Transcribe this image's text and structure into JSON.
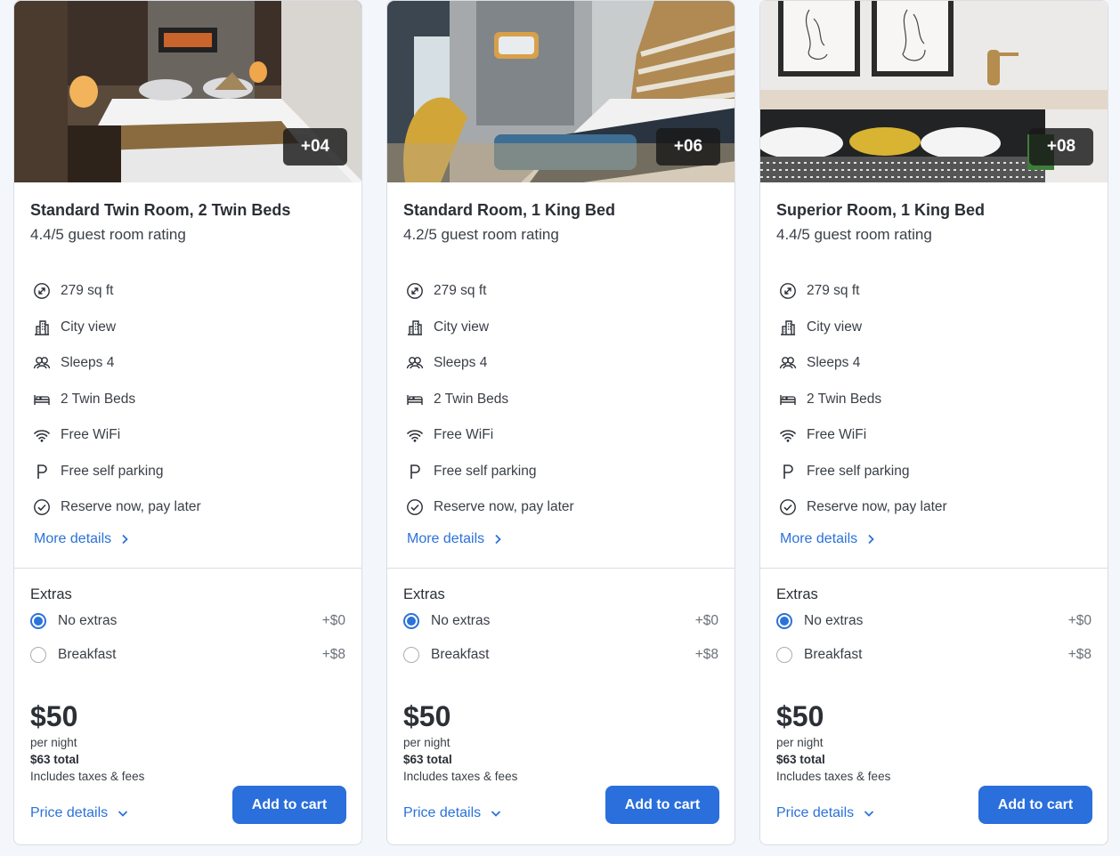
{
  "rooms": [
    {
      "photo_count": "+04",
      "name": "Standard Twin Room, 2 Twin Beds",
      "rating": "4.4/5 guest room rating",
      "amenities": [
        "279 sq ft",
        "City view",
        "Sleeps 4",
        "2 Twin Beds",
        "Free WiFi",
        "Free self parking",
        "Reserve now, pay later"
      ],
      "more_details": "More details",
      "extras_title": "Extras",
      "extras": [
        {
          "label": "No extras",
          "price": "+$0",
          "selected": true
        },
        {
          "label": "Breakfast",
          "price": "+$8",
          "selected": false
        }
      ],
      "price": "$50",
      "per_night": "per night",
      "total": "$63 total",
      "fees": "Includes taxes & fees",
      "price_details": "Price details",
      "add_to_cart": "Add to cart"
    },
    {
      "photo_count": "+06",
      "name": "Standard Room, 1 King Bed",
      "rating": "4.2/5 guest room rating",
      "amenities": [
        "279 sq ft",
        "City view",
        "Sleeps 4",
        "2 Twin Beds",
        "Free WiFi",
        "Free self parking",
        "Reserve now, pay later"
      ],
      "more_details": "More details",
      "extras_title": "Extras",
      "extras": [
        {
          "label": "No extras",
          "price": "+$0",
          "selected": true
        },
        {
          "label": "Breakfast",
          "price": "+$8",
          "selected": false
        }
      ],
      "price": "$50",
      "per_night": "per night",
      "total": "$63 total",
      "fees": "Includes taxes & fees",
      "price_details": "Price details",
      "add_to_cart": "Add to cart"
    },
    {
      "photo_count": "+08",
      "name": "Superior Room, 1 King Bed",
      "rating": "4.4/5 guest room rating",
      "amenities": [
        "279 sq ft",
        "City view",
        "Sleeps 4",
        "2 Twin Beds",
        "Free WiFi",
        "Free self parking",
        "Reserve now, pay later"
      ],
      "more_details": "More details",
      "extras_title": "Extras",
      "extras": [
        {
          "label": "No extras",
          "price": "+$0",
          "selected": true
        },
        {
          "label": "Breakfast",
          "price": "+$8",
          "selected": false
        }
      ],
      "price": "$50",
      "per_night": "per night",
      "total": "$63 total",
      "fees": "Includes taxes & fees",
      "price_details": "Price details",
      "add_to_cart": "Add to cart"
    }
  ],
  "amenity_icons": [
    "resize-icon",
    "city-view-icon",
    "people-icon",
    "bed-icon",
    "wifi-icon",
    "parking-icon",
    "check-circle-icon"
  ],
  "colors": {
    "accent": "#2a6fdb",
    "link": "#2b72d9",
    "background": "#f3f6fb",
    "card_border": "#d9dde3"
  }
}
